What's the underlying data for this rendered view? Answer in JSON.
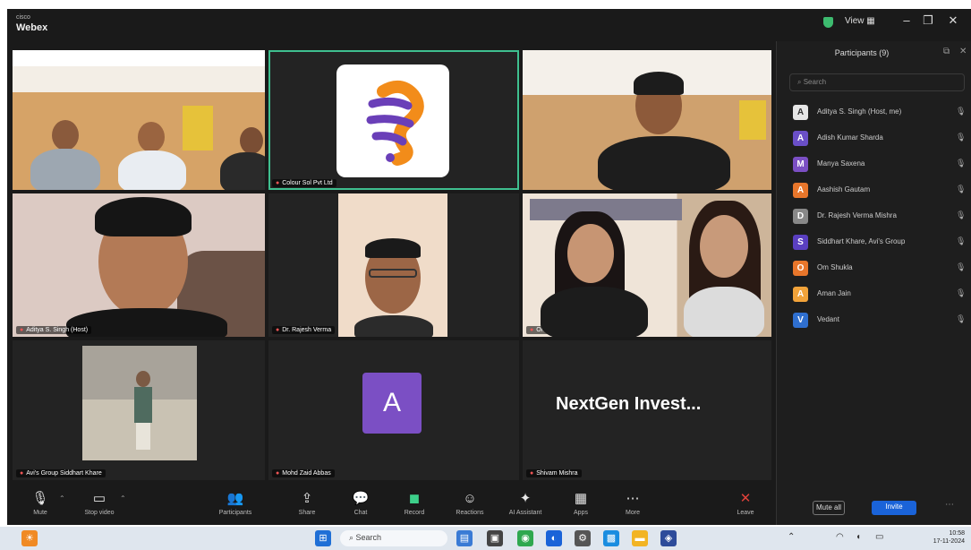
{
  "app": {
    "brand_small": "cisco",
    "brand_big": "Webex"
  },
  "titlebar": {
    "view_label": "View"
  },
  "tiles": [
    {
      "name": ""
    },
    {
      "name": "Colour Sol Pvt Ltd"
    },
    {
      "name": ""
    },
    {
      "name": "Aditya S. Singh (Host)"
    },
    {
      "name": "Dr. Rajesh Verma"
    },
    {
      "name": "Om Jha"
    },
    {
      "name": "Avi's Group  Siddhart Khare"
    },
    {
      "name": "Mohd Zaid Abbas",
      "initial": "A"
    },
    {
      "name": "Shivam Mishra",
      "display": "NextGen Invest..."
    }
  ],
  "panel": {
    "title": "Participants (9)",
    "search_placeholder": "Search",
    "participants": [
      {
        "name": "Aditya S. Singh (Host, me)",
        "initial": "A",
        "color": "#e6e6e6"
      },
      {
        "name": "Adish Kumar Sharda",
        "initial": "A",
        "color": "#6a4fc7"
      },
      {
        "name": "Manya Saxena",
        "initial": "M",
        "color": "#7b4fc4"
      },
      {
        "name": "Aashish Gautam",
        "initial": "A",
        "color": "#e8762b"
      },
      {
        "name": "Dr. Rajesh Verma Mishra",
        "initial": "D",
        "color": "#888888"
      },
      {
        "name": "Siddhart Khare, Avi's Group",
        "initial": "S",
        "color": "#5a3fc0"
      },
      {
        "name": "Om Shukla",
        "initial": "O",
        "color": "#e8762b"
      },
      {
        "name": "Aman Jain",
        "initial": "A",
        "color": "#f2a33a"
      },
      {
        "name": "Vedant",
        "initial": "V",
        "color": "#2f6fcf"
      }
    ],
    "mute_all": "Mute all",
    "invite": "Invite"
  },
  "toolbar": {
    "mute": "Mute",
    "video": "Stop video",
    "share": "Share",
    "record": "Record",
    "reactions": "Reactions",
    "chat": "Chat",
    "apps": "Apps",
    "more": "More",
    "leave": "Leave",
    "participants": "Participants",
    "ai": "AI Assistant"
  },
  "taskbar": {
    "search_label": "Search",
    "time": "10:58",
    "date": "17-11-2024"
  },
  "colors": {
    "accent": "#3fbf8f",
    "invite": "#1a63d8",
    "leave": "#e0413a"
  }
}
